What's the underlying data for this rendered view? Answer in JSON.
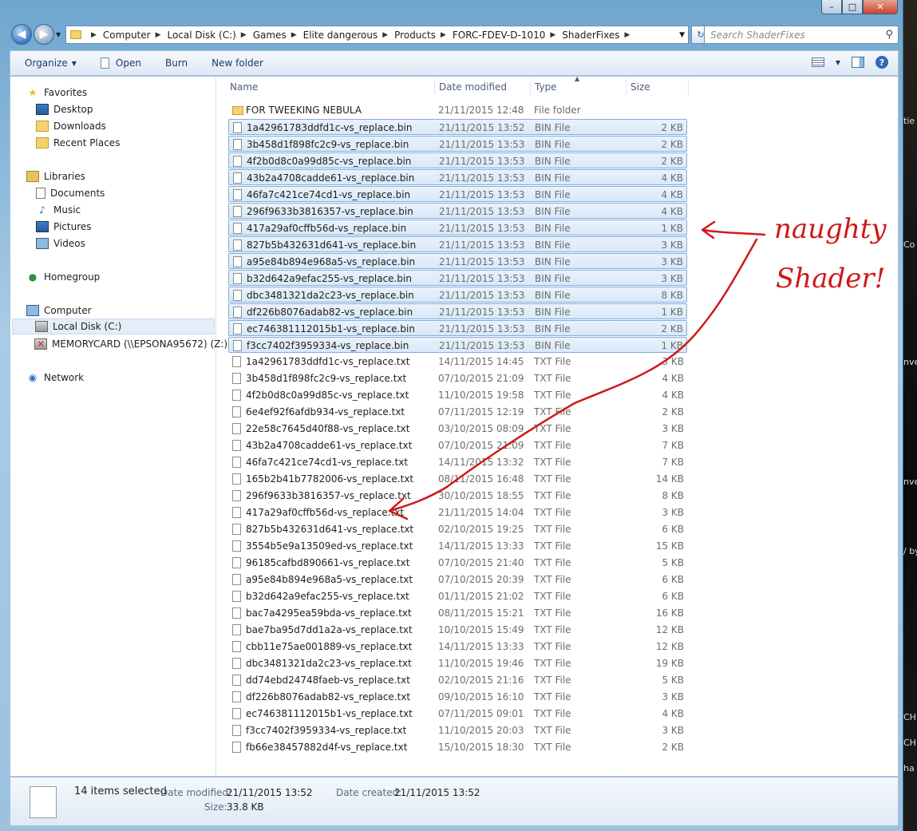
{
  "background_fragments": [
    "tie",
    "Co",
    "nve",
    "nve",
    "/ by",
    "CH",
    "CH",
    "ha"
  ],
  "window": {
    "minimize": "–",
    "maximize": "□",
    "close": "✕"
  },
  "address_bar": {
    "crumbs": [
      "Computer",
      "Local Disk (C:)",
      "Games",
      "Elite dangerous",
      "Products",
      "FORC-FDEV-D-1010",
      "ShaderFixes"
    ],
    "search_placeholder": "Search ShaderFixes"
  },
  "toolbar": {
    "organize": "Organize",
    "open": "Open",
    "burn": "Burn",
    "new_folder": "New folder"
  },
  "nav_pane": {
    "favorites": "Favorites",
    "favorites_items": [
      "Desktop",
      "Downloads",
      "Recent Places"
    ],
    "libraries": "Libraries",
    "library_items": [
      "Documents",
      "Music",
      "Pictures",
      "Videos"
    ],
    "homegroup": "Homegroup",
    "computer": "Computer",
    "computer_items": [
      "Local Disk (C:)",
      "MEMORYCARD (\\\\EPSONA95672) (Z:)"
    ],
    "network": "Network"
  },
  "columns": {
    "name": "Name",
    "date": "Date modified",
    "type": "Type",
    "size": "Size"
  },
  "files": [
    {
      "name": "FOR TWEEKING NEBULA",
      "date": "21/11/2015 12:48",
      "type": "File folder",
      "size": "",
      "folder": true,
      "selected": false
    },
    {
      "name": "1a42961783ddfd1c-vs_replace.bin",
      "date": "21/11/2015 13:52",
      "type": "BIN File",
      "size": "2 KB",
      "selected": true
    },
    {
      "name": "3b458d1f898fc2c9-vs_replace.bin",
      "date": "21/11/2015 13:53",
      "type": "BIN File",
      "size": "2 KB",
      "selected": true
    },
    {
      "name": "4f2b0d8c0a99d85c-vs_replace.bin",
      "date": "21/11/2015 13:53",
      "type": "BIN File",
      "size": "2 KB",
      "selected": true
    },
    {
      "name": "43b2a4708cadde61-vs_replace.bin",
      "date": "21/11/2015 13:53",
      "type": "BIN File",
      "size": "4 KB",
      "selected": true
    },
    {
      "name": "46fa7c421ce74cd1-vs_replace.bin",
      "date": "21/11/2015 13:53",
      "type": "BIN File",
      "size": "4 KB",
      "selected": true
    },
    {
      "name": "296f9633b3816357-vs_replace.bin",
      "date": "21/11/2015 13:53",
      "type": "BIN File",
      "size": "4 KB",
      "selected": true
    },
    {
      "name": "417a29af0cffb56d-vs_replace.bin",
      "date": "21/11/2015 13:53",
      "type": "BIN File",
      "size": "1 KB",
      "selected": true
    },
    {
      "name": "827b5b432631d641-vs_replace.bin",
      "date": "21/11/2015 13:53",
      "type": "BIN File",
      "size": "3 KB",
      "selected": true
    },
    {
      "name": "a95e84b894e968a5-vs_replace.bin",
      "date": "21/11/2015 13:53",
      "type": "BIN File",
      "size": "3 KB",
      "selected": true
    },
    {
      "name": "b32d642a9efac255-vs_replace.bin",
      "date": "21/11/2015 13:53",
      "type": "BIN File",
      "size": "3 KB",
      "selected": true
    },
    {
      "name": "dbc3481321da2c23-vs_replace.bin",
      "date": "21/11/2015 13:53",
      "type": "BIN File",
      "size": "8 KB",
      "selected": true
    },
    {
      "name": "df226b8076adab82-vs_replace.bin",
      "date": "21/11/2015 13:53",
      "type": "BIN File",
      "size": "1 KB",
      "selected": true
    },
    {
      "name": "ec746381112015b1-vs_replace.bin",
      "date": "21/11/2015 13:53",
      "type": "BIN File",
      "size": "2 KB",
      "selected": true
    },
    {
      "name": "f3cc7402f3959334-vs_replace.bin",
      "date": "21/11/2015 13:53",
      "type": "BIN File",
      "size": "1 KB",
      "selected": true
    },
    {
      "name": "1a42961783ddfd1c-vs_replace.txt",
      "date": "14/11/2015 14:45",
      "type": "TXT File",
      "size": "3 KB",
      "selected": false
    },
    {
      "name": "3b458d1f898fc2c9-vs_replace.txt",
      "date": "07/10/2015 21:09",
      "type": "TXT File",
      "size": "4 KB",
      "selected": false
    },
    {
      "name": "4f2b0d8c0a99d85c-vs_replace.txt",
      "date": "11/10/2015 19:58",
      "type": "TXT File",
      "size": "4 KB",
      "selected": false
    },
    {
      "name": "6e4ef92f6afdb934-vs_replace.txt",
      "date": "07/11/2015 12:19",
      "type": "TXT File",
      "size": "2 KB",
      "selected": false
    },
    {
      "name": "22e58c7645d40f88-vs_replace.txt",
      "date": "03/10/2015 08:09",
      "type": "TXT File",
      "size": "3 KB",
      "selected": false
    },
    {
      "name": "43b2a4708cadde61-vs_replace.txt",
      "date": "07/10/2015 21:09",
      "type": "TXT File",
      "size": "7 KB",
      "selected": false
    },
    {
      "name": "46fa7c421ce74cd1-vs_replace.txt",
      "date": "14/11/2015 13:32",
      "type": "TXT File",
      "size": "7 KB",
      "selected": false
    },
    {
      "name": "165b2b41b7782006-vs_replace.txt",
      "date": "08/11/2015 16:48",
      "type": "TXT File",
      "size": "14 KB",
      "selected": false
    },
    {
      "name": "296f9633b3816357-vs_replace.txt",
      "date": "30/10/2015 18:55",
      "type": "TXT File",
      "size": "8 KB",
      "selected": false
    },
    {
      "name": "417a29af0cffb56d-vs_replace.txt",
      "date": "21/11/2015 14:04",
      "type": "TXT File",
      "size": "3 KB",
      "selected": false
    },
    {
      "name": "827b5b432631d641-vs_replace.txt",
      "date": "02/10/2015 19:25",
      "type": "TXT File",
      "size": "6 KB",
      "selected": false
    },
    {
      "name": "3554b5e9a13509ed-vs_replace.txt",
      "date": "14/11/2015 13:33",
      "type": "TXT File",
      "size": "15 KB",
      "selected": false
    },
    {
      "name": "96185cafbd890661-vs_replace.txt",
      "date": "07/10/2015 21:40",
      "type": "TXT File",
      "size": "5 KB",
      "selected": false
    },
    {
      "name": "a95e84b894e968a5-vs_replace.txt",
      "date": "07/10/2015 20:39",
      "type": "TXT File",
      "size": "6 KB",
      "selected": false
    },
    {
      "name": "b32d642a9efac255-vs_replace.txt",
      "date": "01/11/2015 21:02",
      "type": "TXT File",
      "size": "6 KB",
      "selected": false
    },
    {
      "name": "bac7a4295ea59bda-vs_replace.txt",
      "date": "08/11/2015 15:21",
      "type": "TXT File",
      "size": "16 KB",
      "selected": false
    },
    {
      "name": "bae7ba95d7dd1a2a-vs_replace.txt",
      "date": "10/10/2015 15:49",
      "type": "TXT File",
      "size": "12 KB",
      "selected": false
    },
    {
      "name": "cbb11e75ae001889-vs_replace.txt",
      "date": "14/11/2015 13:33",
      "type": "TXT File",
      "size": "12 KB",
      "selected": false
    },
    {
      "name": "dbc3481321da2c23-vs_replace.txt",
      "date": "11/10/2015 19:46",
      "type": "TXT File",
      "size": "19 KB",
      "selected": false
    },
    {
      "name": "dd74ebd24748faeb-vs_replace.txt",
      "date": "02/10/2015 21:16",
      "type": "TXT File",
      "size": "5 KB",
      "selected": false
    },
    {
      "name": "df226b8076adab82-vs_replace.txt",
      "date": "09/10/2015 16:10",
      "type": "TXT File",
      "size": "3 KB",
      "selected": false
    },
    {
      "name": "ec746381112015b1-vs_replace.txt",
      "date": "07/11/2015 09:01",
      "type": "TXT File",
      "size": "4 KB",
      "selected": false
    },
    {
      "name": "f3cc7402f3959334-vs_replace.txt",
      "date": "11/10/2015 20:03",
      "type": "TXT File",
      "size": "3 KB",
      "selected": false
    },
    {
      "name": "fb66e38457882d4f-vs_replace.txt",
      "date": "15/10/2015 18:30",
      "type": "TXT File",
      "size": "2 KB",
      "selected": false
    }
  ],
  "details": {
    "count": "14 items selected",
    "modified_label": "Date modified:",
    "modified_value": "21/11/2015 13:52",
    "created_label": "Date created:",
    "created_value": "21/11/2015 13:52",
    "size_label": "Size:",
    "size_value": "33.8 KB"
  },
  "annotation": {
    "line1": "naughty",
    "line2": "Shader!",
    "color": "#d01818"
  }
}
